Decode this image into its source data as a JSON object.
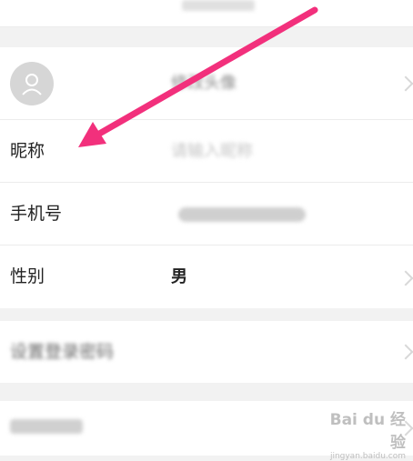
{
  "avatar_section": {
    "label": "修改头像"
  },
  "nickname": {
    "label": "昵称",
    "placeholder": "请输入昵称"
  },
  "phone": {
    "label": "手机号"
  },
  "gender": {
    "label": "性别",
    "value": "男"
  },
  "password": {
    "label": "设置登录密码"
  },
  "watermark": {
    "brand": "Bai du 经验",
    "url": "jingyan.baidu.com"
  },
  "colors": {
    "arrow": "#f2307c",
    "background": "#f2f2f2"
  }
}
